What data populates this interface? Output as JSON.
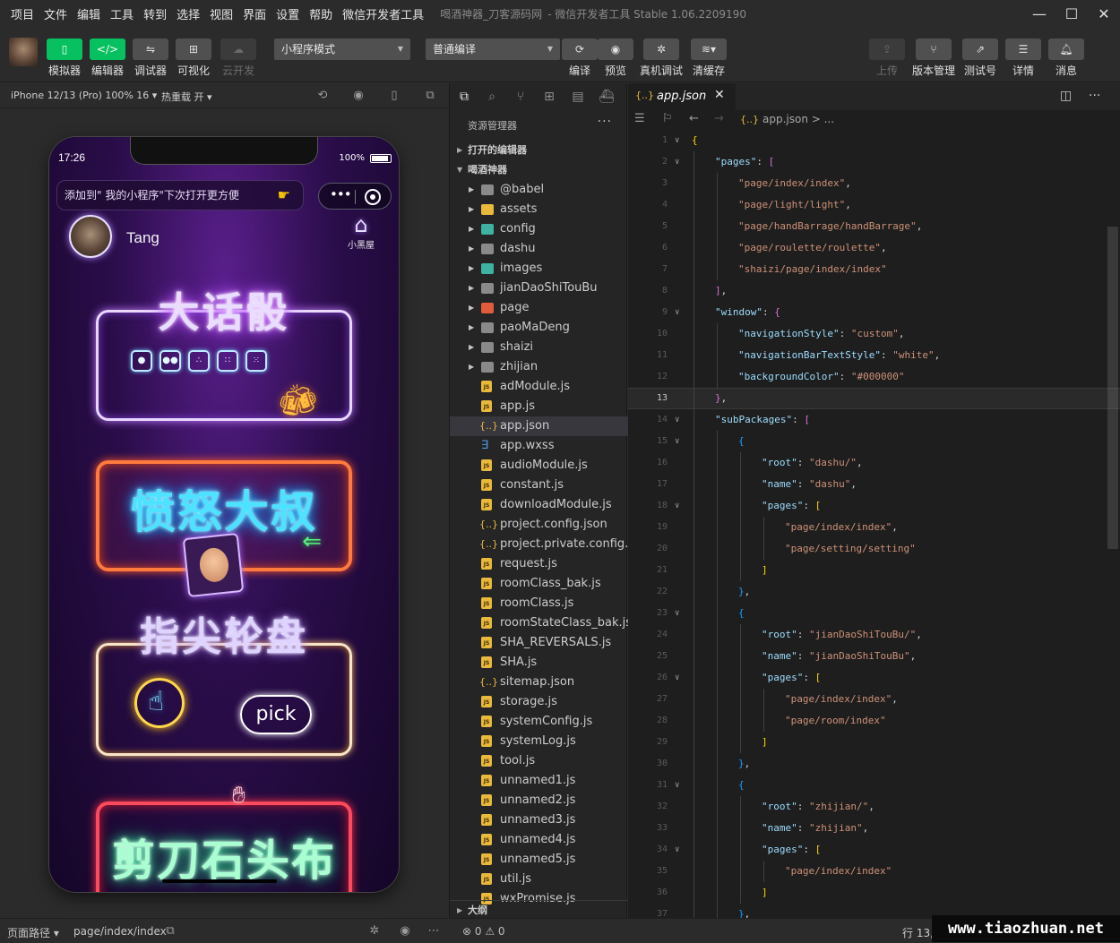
{
  "menubar": {
    "items": [
      "项目",
      "文件",
      "编辑",
      "工具",
      "转到",
      "选择",
      "视图",
      "界面",
      "设置",
      "帮助",
      "微信开发者工具"
    ],
    "title": "喝酒神器_刀客源码网",
    "app_version": "- 微信开发者工具 Stable 1.06.2209190"
  },
  "toolbar": {
    "simulator": "模拟器",
    "editor": "编辑器",
    "debugger": "调试器",
    "visual": "可视化",
    "cloud": "云开发",
    "mode_select": "小程序模式",
    "compile_select": "普通编译",
    "compile": "编译",
    "preview": "预览",
    "remote_debug": "真机调试",
    "clear_cache": "清缓存",
    "upload": "上传",
    "version_mgmt": "版本管理",
    "test_account": "测试号",
    "details": "详情",
    "messages": "消息"
  },
  "simulator": {
    "device": "iPhone 12/13 (Pro) 100% 16 ▾",
    "hot_reload": "热重载 开 ▾",
    "status_time": "17:26",
    "battery": "100%",
    "add_tip": "添加到\" 我的小程序\"下次打开更方便",
    "user_name": "Tang",
    "house_label": "小黑屋",
    "games": [
      {
        "title": "大话骰"
      },
      {
        "title": "愤怒大叔"
      },
      {
        "title": "指尖轮盘"
      },
      {
        "title": "剪刀石头布"
      }
    ],
    "pick_label": "pick",
    "page_path_label": "页面路径 ▾",
    "page_path": "page/index/index"
  },
  "explorer": {
    "header": "资源管理器",
    "open_editors": "打开的编辑器",
    "project": "喝酒神器",
    "outline": "大纲",
    "items": [
      {
        "name": "@babel",
        "type": "folder"
      },
      {
        "name": "assets",
        "type": "folder-yellow"
      },
      {
        "name": "config",
        "type": "folder-teal"
      },
      {
        "name": "dashu",
        "type": "folder"
      },
      {
        "name": "images",
        "type": "folder-teal"
      },
      {
        "name": "jianDaoShiTouBu",
        "type": "folder"
      },
      {
        "name": "page",
        "type": "folder-red"
      },
      {
        "name": "paoMaDeng",
        "type": "folder"
      },
      {
        "name": "shaizi",
        "type": "folder"
      },
      {
        "name": "zhijian",
        "type": "folder"
      },
      {
        "name": "adModule.js",
        "type": "js"
      },
      {
        "name": "app.js",
        "type": "js"
      },
      {
        "name": "app.json",
        "type": "json",
        "selected": true
      },
      {
        "name": "app.wxss",
        "type": "wxss"
      },
      {
        "name": "audioModule.js",
        "type": "js"
      },
      {
        "name": "constant.js",
        "type": "js"
      },
      {
        "name": "downloadModule.js",
        "type": "js"
      },
      {
        "name": "project.config.json",
        "type": "json"
      },
      {
        "name": "project.private.config.js...",
        "type": "json"
      },
      {
        "name": "request.js",
        "type": "js"
      },
      {
        "name": "roomClass_bak.js",
        "type": "js"
      },
      {
        "name": "roomClass.js",
        "type": "js"
      },
      {
        "name": "roomStateClass_bak.js",
        "type": "js"
      },
      {
        "name": "SHA_REVERSALS.js",
        "type": "js"
      },
      {
        "name": "SHA.js",
        "type": "js"
      },
      {
        "name": "sitemap.json",
        "type": "json"
      },
      {
        "name": "storage.js",
        "type": "js"
      },
      {
        "name": "systemConfig.js",
        "type": "js"
      },
      {
        "name": "systemLog.js",
        "type": "js"
      },
      {
        "name": "tool.js",
        "type": "js"
      },
      {
        "name": "unnamed1.js",
        "type": "js"
      },
      {
        "name": "unnamed2.js",
        "type": "js"
      },
      {
        "name": "unnamed3.js",
        "type": "js"
      },
      {
        "name": "unnamed4.js",
        "type": "js"
      },
      {
        "name": "unnamed5.js",
        "type": "js"
      },
      {
        "name": "util.js",
        "type": "js"
      },
      {
        "name": "wxPromise.js",
        "type": "js"
      }
    ],
    "problems": "⊗ 0 ⚠ 0"
  },
  "editor": {
    "tab_name": "app.json",
    "breadcrumb": "app.json > ...",
    "cursor_pos": "行 13,",
    "lines": [
      {
        "n": 1,
        "fold": "∨",
        "indent": 0,
        "tokens": [
          [
            "b1",
            "{"
          ]
        ]
      },
      {
        "n": 2,
        "fold": "∨",
        "indent": 1,
        "tokens": [
          [
            "k",
            "\"pages\""
          ],
          [
            "p",
            ": "
          ],
          [
            "b2",
            "["
          ]
        ]
      },
      {
        "n": 3,
        "fold": "",
        "indent": 2,
        "tokens": [
          [
            "s",
            "\"page/index/index\""
          ],
          [
            "p",
            ","
          ]
        ]
      },
      {
        "n": 4,
        "fold": "",
        "indent": 2,
        "tokens": [
          [
            "s",
            "\"page/light/light\""
          ],
          [
            "p",
            ","
          ]
        ]
      },
      {
        "n": 5,
        "fold": "",
        "indent": 2,
        "tokens": [
          [
            "s",
            "\"page/handBarrage/handBarrage\""
          ],
          [
            "p",
            ","
          ]
        ]
      },
      {
        "n": 6,
        "fold": "",
        "indent": 2,
        "tokens": [
          [
            "s",
            "\"page/roulette/roulette\""
          ],
          [
            "p",
            ","
          ]
        ]
      },
      {
        "n": 7,
        "fold": "",
        "indent": 2,
        "tokens": [
          [
            "s",
            "\"shaizi/page/index/index\""
          ]
        ]
      },
      {
        "n": 8,
        "fold": "",
        "indent": 1,
        "tokens": [
          [
            "b2",
            "]"
          ],
          [
            "p",
            ","
          ]
        ]
      },
      {
        "n": 9,
        "fold": "∨",
        "indent": 1,
        "tokens": [
          [
            "k",
            "\"window\""
          ],
          [
            "p",
            ": "
          ],
          [
            "b2",
            "{"
          ]
        ]
      },
      {
        "n": 10,
        "fold": "",
        "indent": 2,
        "tokens": [
          [
            "k",
            "\"navigationStyle\""
          ],
          [
            "p",
            ": "
          ],
          [
            "s",
            "\"custom\""
          ],
          [
            "p",
            ","
          ]
        ]
      },
      {
        "n": 11,
        "fold": "",
        "indent": 2,
        "tokens": [
          [
            "k",
            "\"navigationBarTextStyle\""
          ],
          [
            "p",
            ": "
          ],
          [
            "s",
            "\"white\""
          ],
          [
            "p",
            ","
          ]
        ]
      },
      {
        "n": 12,
        "fold": "",
        "indent": 2,
        "tokens": [
          [
            "k",
            "\"backgroundColor\""
          ],
          [
            "p",
            ": "
          ],
          [
            "s",
            "\"#000000\""
          ]
        ]
      },
      {
        "n": 13,
        "fold": "",
        "indent": 1,
        "current": true,
        "tokens": [
          [
            "b2",
            "}"
          ],
          [
            "p",
            ","
          ]
        ]
      },
      {
        "n": 14,
        "fold": "∨",
        "indent": 1,
        "tokens": [
          [
            "k",
            "\"subPackages\""
          ],
          [
            "p",
            ": "
          ],
          [
            "b2",
            "["
          ]
        ]
      },
      {
        "n": 15,
        "fold": "∨",
        "indent": 2,
        "tokens": [
          [
            "b3",
            "{"
          ]
        ]
      },
      {
        "n": 16,
        "fold": "",
        "indent": 3,
        "tokens": [
          [
            "k",
            "\"root\""
          ],
          [
            "p",
            ": "
          ],
          [
            "s",
            "\"dashu/\""
          ],
          [
            "p",
            ","
          ]
        ]
      },
      {
        "n": 17,
        "fold": "",
        "indent": 3,
        "tokens": [
          [
            "k",
            "\"name\""
          ],
          [
            "p",
            ": "
          ],
          [
            "s",
            "\"dashu\""
          ],
          [
            "p",
            ","
          ]
        ]
      },
      {
        "n": 18,
        "fold": "∨",
        "indent": 3,
        "tokens": [
          [
            "k",
            "\"pages\""
          ],
          [
            "p",
            ": "
          ],
          [
            "b1",
            "["
          ]
        ]
      },
      {
        "n": 19,
        "fold": "",
        "indent": 4,
        "tokens": [
          [
            "s",
            "\"page/index/index\""
          ],
          [
            "p",
            ","
          ]
        ]
      },
      {
        "n": 20,
        "fold": "",
        "indent": 4,
        "tokens": [
          [
            "s",
            "\"page/setting/setting\""
          ]
        ]
      },
      {
        "n": 21,
        "fold": "",
        "indent": 3,
        "tokens": [
          [
            "b1",
            "]"
          ]
        ]
      },
      {
        "n": 22,
        "fold": "",
        "indent": 2,
        "tokens": [
          [
            "b3",
            "}"
          ],
          [
            "p",
            ","
          ]
        ]
      },
      {
        "n": 23,
        "fold": "∨",
        "indent": 2,
        "tokens": [
          [
            "b3",
            "{"
          ]
        ]
      },
      {
        "n": 24,
        "fold": "",
        "indent": 3,
        "tokens": [
          [
            "k",
            "\"root\""
          ],
          [
            "p",
            ": "
          ],
          [
            "s",
            "\"jianDaoShiTouBu/\""
          ],
          [
            "p",
            ","
          ]
        ]
      },
      {
        "n": 25,
        "fold": "",
        "indent": 3,
        "tokens": [
          [
            "k",
            "\"name\""
          ],
          [
            "p",
            ": "
          ],
          [
            "s",
            "\"jianDaoShiTouBu\""
          ],
          [
            "p",
            ","
          ]
        ]
      },
      {
        "n": 26,
        "fold": "∨",
        "indent": 3,
        "tokens": [
          [
            "k",
            "\"pages\""
          ],
          [
            "p",
            ": "
          ],
          [
            "b1",
            "["
          ]
        ]
      },
      {
        "n": 27,
        "fold": "",
        "indent": 4,
        "tokens": [
          [
            "s",
            "\"page/index/index\""
          ],
          [
            "p",
            ","
          ]
        ]
      },
      {
        "n": 28,
        "fold": "",
        "indent": 4,
        "tokens": [
          [
            "s",
            "\"page/room/index\""
          ]
        ]
      },
      {
        "n": 29,
        "fold": "",
        "indent": 3,
        "tokens": [
          [
            "b1",
            "]"
          ]
        ]
      },
      {
        "n": 30,
        "fold": "",
        "indent": 2,
        "tokens": [
          [
            "b3",
            "}"
          ],
          [
            "p",
            ","
          ]
        ]
      },
      {
        "n": 31,
        "fold": "∨",
        "indent": 2,
        "tokens": [
          [
            "b3",
            "{"
          ]
        ]
      },
      {
        "n": 32,
        "fold": "",
        "indent": 3,
        "tokens": [
          [
            "k",
            "\"root\""
          ],
          [
            "p",
            ": "
          ],
          [
            "s",
            "\"zhijian/\""
          ],
          [
            "p",
            ","
          ]
        ]
      },
      {
        "n": 33,
        "fold": "",
        "indent": 3,
        "tokens": [
          [
            "k",
            "\"name\""
          ],
          [
            "p",
            ": "
          ],
          [
            "s",
            "\"zhijian\""
          ],
          [
            "p",
            ","
          ]
        ]
      },
      {
        "n": 34,
        "fold": "∨",
        "indent": 3,
        "tokens": [
          [
            "k",
            "\"pages\""
          ],
          [
            "p",
            ": "
          ],
          [
            "b1",
            "["
          ]
        ]
      },
      {
        "n": 35,
        "fold": "",
        "indent": 4,
        "tokens": [
          [
            "s",
            "\"page/index/index\""
          ]
        ]
      },
      {
        "n": 36,
        "fold": "",
        "indent": 3,
        "tokens": [
          [
            "b1",
            "]"
          ]
        ]
      },
      {
        "n": 37,
        "fold": "",
        "indent": 2,
        "tokens": [
          [
            "b3",
            "}"
          ],
          [
            "p",
            ","
          ]
        ]
      }
    ]
  },
  "watermark": "www.tiaozhuan.net",
  "colors": {
    "accent_green": "#07c160",
    "editor_bg": "#1e1e1e",
    "panel_bg": "#252526",
    "json_key": "#9cdcfe",
    "json_string": "#ce9178"
  }
}
